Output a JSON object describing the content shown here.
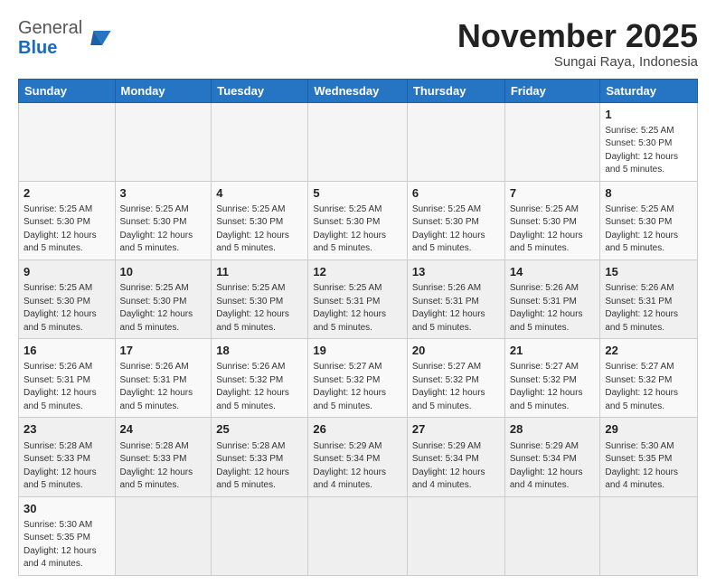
{
  "logo": {
    "general": "General",
    "blue": "Blue"
  },
  "title": "November 2025",
  "subtitle": "Sungai Raya, Indonesia",
  "days_of_week": [
    "Sunday",
    "Monday",
    "Tuesday",
    "Wednesday",
    "Thursday",
    "Friday",
    "Saturday"
  ],
  "weeks": [
    {
      "shade": false,
      "days": [
        {
          "num": "",
          "info": ""
        },
        {
          "num": "",
          "info": ""
        },
        {
          "num": "",
          "info": ""
        },
        {
          "num": "",
          "info": ""
        },
        {
          "num": "",
          "info": ""
        },
        {
          "num": "",
          "info": ""
        },
        {
          "num": "1",
          "info": "Sunrise: 5:25 AM\nSunset: 5:30 PM\nDaylight: 12 hours\nand 5 minutes."
        }
      ]
    },
    {
      "shade": false,
      "days": [
        {
          "num": "2",
          "info": "Sunrise: 5:25 AM\nSunset: 5:30 PM\nDaylight: 12 hours\nand 5 minutes."
        },
        {
          "num": "3",
          "info": "Sunrise: 5:25 AM\nSunset: 5:30 PM\nDaylight: 12 hours\nand 5 minutes."
        },
        {
          "num": "4",
          "info": "Sunrise: 5:25 AM\nSunset: 5:30 PM\nDaylight: 12 hours\nand 5 minutes."
        },
        {
          "num": "5",
          "info": "Sunrise: 5:25 AM\nSunset: 5:30 PM\nDaylight: 12 hours\nand 5 minutes."
        },
        {
          "num": "6",
          "info": "Sunrise: 5:25 AM\nSunset: 5:30 PM\nDaylight: 12 hours\nand 5 minutes."
        },
        {
          "num": "7",
          "info": "Sunrise: 5:25 AM\nSunset: 5:30 PM\nDaylight: 12 hours\nand 5 minutes."
        },
        {
          "num": "8",
          "info": "Sunrise: 5:25 AM\nSunset: 5:30 PM\nDaylight: 12 hours\nand 5 minutes."
        }
      ]
    },
    {
      "shade": true,
      "days": [
        {
          "num": "9",
          "info": "Sunrise: 5:25 AM\nSunset: 5:30 PM\nDaylight: 12 hours\nand 5 minutes."
        },
        {
          "num": "10",
          "info": "Sunrise: 5:25 AM\nSunset: 5:30 PM\nDaylight: 12 hours\nand 5 minutes."
        },
        {
          "num": "11",
          "info": "Sunrise: 5:25 AM\nSunset: 5:30 PM\nDaylight: 12 hours\nand 5 minutes."
        },
        {
          "num": "12",
          "info": "Sunrise: 5:25 AM\nSunset: 5:31 PM\nDaylight: 12 hours\nand 5 minutes."
        },
        {
          "num": "13",
          "info": "Sunrise: 5:26 AM\nSunset: 5:31 PM\nDaylight: 12 hours\nand 5 minutes."
        },
        {
          "num": "14",
          "info": "Sunrise: 5:26 AM\nSunset: 5:31 PM\nDaylight: 12 hours\nand 5 minutes."
        },
        {
          "num": "15",
          "info": "Sunrise: 5:26 AM\nSunset: 5:31 PM\nDaylight: 12 hours\nand 5 minutes."
        }
      ]
    },
    {
      "shade": false,
      "days": [
        {
          "num": "16",
          "info": "Sunrise: 5:26 AM\nSunset: 5:31 PM\nDaylight: 12 hours\nand 5 minutes."
        },
        {
          "num": "17",
          "info": "Sunrise: 5:26 AM\nSunset: 5:31 PM\nDaylight: 12 hours\nand 5 minutes."
        },
        {
          "num": "18",
          "info": "Sunrise: 5:26 AM\nSunset: 5:32 PM\nDaylight: 12 hours\nand 5 minutes."
        },
        {
          "num": "19",
          "info": "Sunrise: 5:27 AM\nSunset: 5:32 PM\nDaylight: 12 hours\nand 5 minutes."
        },
        {
          "num": "20",
          "info": "Sunrise: 5:27 AM\nSunset: 5:32 PM\nDaylight: 12 hours\nand 5 minutes."
        },
        {
          "num": "21",
          "info": "Sunrise: 5:27 AM\nSunset: 5:32 PM\nDaylight: 12 hours\nand 5 minutes."
        },
        {
          "num": "22",
          "info": "Sunrise: 5:27 AM\nSunset: 5:32 PM\nDaylight: 12 hours\nand 5 minutes."
        }
      ]
    },
    {
      "shade": true,
      "days": [
        {
          "num": "23",
          "info": "Sunrise: 5:28 AM\nSunset: 5:33 PM\nDaylight: 12 hours\nand 5 minutes."
        },
        {
          "num": "24",
          "info": "Sunrise: 5:28 AM\nSunset: 5:33 PM\nDaylight: 12 hours\nand 5 minutes."
        },
        {
          "num": "25",
          "info": "Sunrise: 5:28 AM\nSunset: 5:33 PM\nDaylight: 12 hours\nand 5 minutes."
        },
        {
          "num": "26",
          "info": "Sunrise: 5:29 AM\nSunset: 5:34 PM\nDaylight: 12 hours\nand 4 minutes."
        },
        {
          "num": "27",
          "info": "Sunrise: 5:29 AM\nSunset: 5:34 PM\nDaylight: 12 hours\nand 4 minutes."
        },
        {
          "num": "28",
          "info": "Sunrise: 5:29 AM\nSunset: 5:34 PM\nDaylight: 12 hours\nand 4 minutes."
        },
        {
          "num": "29",
          "info": "Sunrise: 5:30 AM\nSunset: 5:35 PM\nDaylight: 12 hours\nand 4 minutes."
        }
      ]
    },
    {
      "shade": false,
      "days": [
        {
          "num": "30",
          "info": "Sunrise: 5:30 AM\nSunset: 5:35 PM\nDaylight: 12 hours\nand 4 minutes."
        },
        {
          "num": "",
          "info": ""
        },
        {
          "num": "",
          "info": ""
        },
        {
          "num": "",
          "info": ""
        },
        {
          "num": "",
          "info": ""
        },
        {
          "num": "",
          "info": ""
        },
        {
          "num": "",
          "info": ""
        }
      ]
    }
  ]
}
